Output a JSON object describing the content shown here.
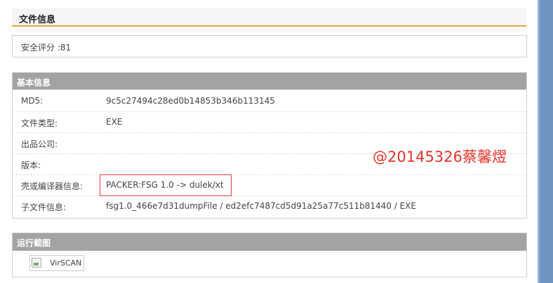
{
  "file_info": {
    "title": "文件信息"
  },
  "security": {
    "score_text": "安全评分 :81"
  },
  "basic_info": {
    "title": "基本信息",
    "rows": [
      {
        "label": "MD5:",
        "value": "9c5c27494c28ed0b14853b346b113145"
      },
      {
        "label": "文件类型:",
        "value": "EXE"
      },
      {
        "label": "出品公司:",
        "value": ""
      },
      {
        "label": "版本:",
        "value": ""
      },
      {
        "label": "壳或编译器信息:",
        "value": "PACKER:FSG 1.0 -> dulek/xt"
      },
      {
        "label": "子文件信息:",
        "value": "fsg1.0_466e7d31dumpFile / ed2efc7487cd5d91a25a77c511b81440 / EXE"
      }
    ]
  },
  "watermark": "@20145326蔡馨熤",
  "screenshot": {
    "title": "运行截图",
    "alt": "VirSCAN"
  },
  "colors": {
    "accent": "#e8a23a",
    "bar": "#a3a3a3",
    "sidebar": "#6e95c0",
    "highlight": "#e04040"
  }
}
